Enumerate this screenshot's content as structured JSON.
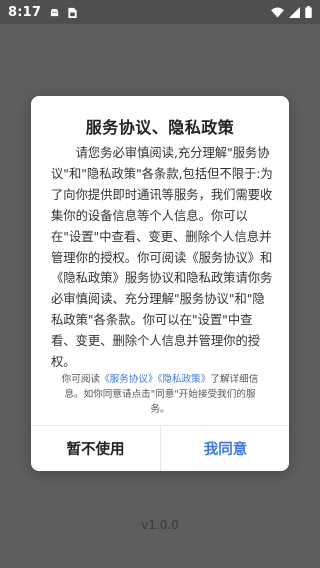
{
  "status_bar": {
    "time": "8:17",
    "left_icons": [
      "android-notification-icon",
      "sim-card-icon"
    ],
    "right_icons": [
      "wifi-icon",
      "signal-icon",
      "battery-icon"
    ]
  },
  "dialog": {
    "title": "服务协议、隐私政策",
    "body": "请您务必审慎阅读,充分理解\"服务协议\"和\"隐私政策\"各条款,包括但不限于:为了向你提供即时通讯等服务，我们需要收集你的设备信息等个人信息。你可以在\"设置\"中查看、变更、删除个人信息并管理你的授权。你可阅读《服务协议》和《隐私政策》服务协议和隐私政策请你务必审慎阅读、充分理解\"服务协议\"和\"隐私政策\"各条款。你可以在\"设置\"中查看、变更、删除个人信息并管理你的授权。",
    "note": {
      "prefix": "你可阅读",
      "link_terms": "《服务协议》",
      "link_privacy": "《隐私政策》",
      "suffix": "了解详细信息。如你同意请点击\"同意\"开始接受我们的服务。"
    },
    "decline_label": "暂不使用",
    "agree_label": "我同意"
  },
  "footer": {
    "version": "v1.0.0"
  },
  "colors": {
    "accent": "#3f78d8",
    "backdrop": "#5e5e5e",
    "status_bar": "#4f4f4f"
  }
}
